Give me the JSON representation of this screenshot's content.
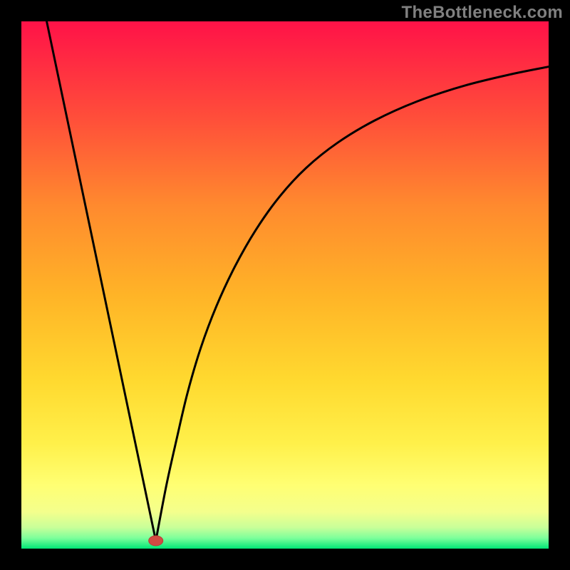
{
  "watermark": "TheBottleneck.com",
  "colors": {
    "bg": "#000000",
    "curve": "#000000",
    "marker_fill": "#d24a43",
    "marker_stroke": "#b83d37",
    "gradient_top": "#ff1248",
    "gradient_mid1": "#ff6b2e",
    "gradient_mid2": "#ffb427",
    "gradient_mid3": "#ffe233",
    "gradient_mid4": "#ffff66",
    "gradient_bottom": "#00e676"
  },
  "chart_data": {
    "type": "line",
    "title": "",
    "xlabel": "",
    "ylabel": "",
    "xlim": [
      0,
      1
    ],
    "ylim": [
      0,
      1
    ],
    "marker": {
      "x": 0.255,
      "y": 0.015
    },
    "left_branch": {
      "x": [
        0.048,
        0.255
      ],
      "y": [
        1.0,
        0.015
      ]
    },
    "right_branch_x": [
      0.255,
      0.275,
      0.295,
      0.315,
      0.34,
      0.37,
      0.405,
      0.445,
      0.49,
      0.54,
      0.6,
      0.67,
      0.75,
      0.84,
      0.93,
      1.0
    ],
    "right_branch_y": [
      0.015,
      0.12,
      0.21,
      0.295,
      0.38,
      0.46,
      0.535,
      0.605,
      0.668,
      0.722,
      0.77,
      0.812,
      0.848,
      0.878,
      0.9,
      0.914
    ]
  }
}
